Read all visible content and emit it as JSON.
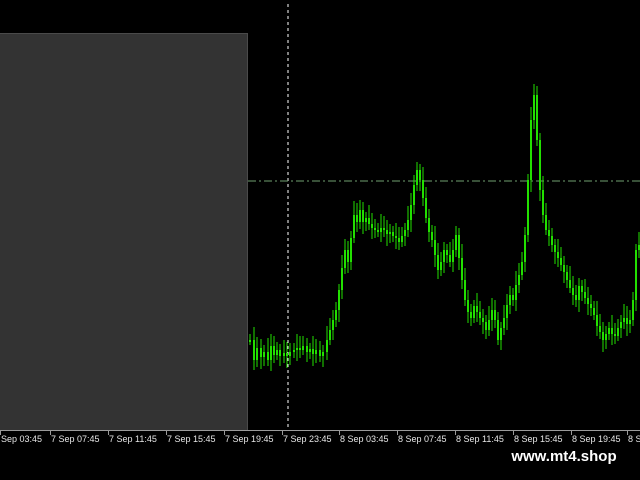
{
  "chart": {
    "type": "candlestick",
    "candle_color": "#22e000",
    "background_color": "#000000",
    "panel_color": "#333333",
    "gridline_color": "#ffffff",
    "price_line_color": "#6f9f6f",
    "vertical_gridline": true,
    "horizontal_price_line": true
  },
  "time_axis": {
    "labels": [
      "Sep 03:45",
      "7 Sep 07:45",
      "7 Sep 11:45",
      "7 Sep 15:45",
      "7 Sep 19:45",
      "7 Sep 23:45",
      "8 Sep 03:45",
      "8 Sep 07:45",
      "8 Sep 11:45",
      "8 Sep 15:45",
      "8 Sep 19:45",
      "8 S"
    ]
  },
  "watermark": {
    "text": "www.mt4.shop"
  }
}
